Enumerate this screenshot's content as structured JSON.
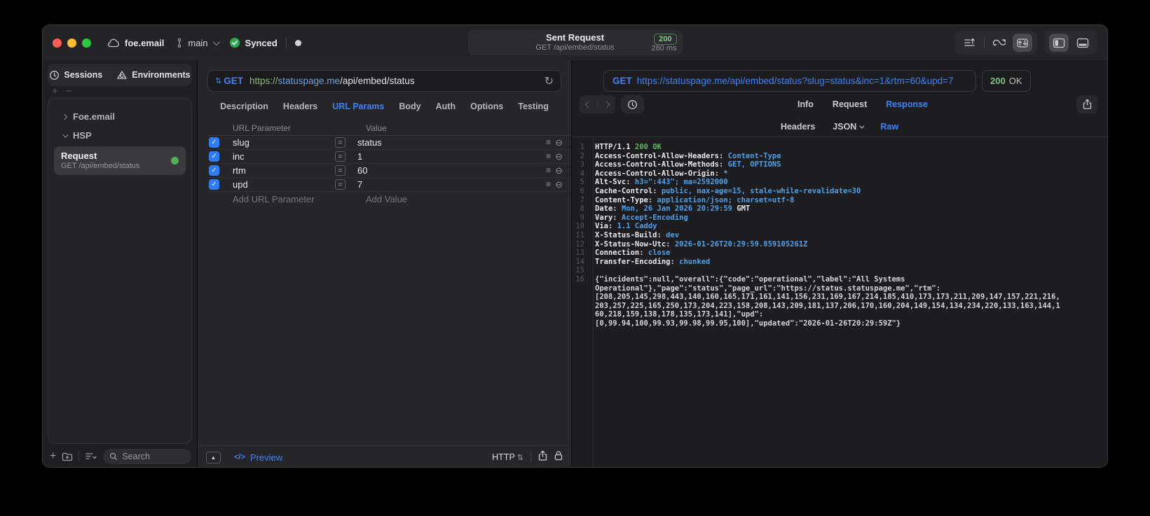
{
  "titlebar": {
    "workspace": "foe.email",
    "branch": "main",
    "sync_label": "Synced",
    "request_title": "Sent Request",
    "request_subtitle": "GET /api/embed/status",
    "status_code": "200",
    "duration": "280 ms"
  },
  "sidebar": {
    "tabs": [
      {
        "label": "Sessions"
      },
      {
        "label": "Environments"
      }
    ],
    "groups": [
      {
        "label": "Foe.email",
        "state": "collapsed"
      },
      {
        "label": "HSP",
        "state": "expanded"
      }
    ],
    "request": {
      "title": "Request",
      "subtitle": "GET /api/embed/status"
    },
    "search_placeholder": "Search"
  },
  "request_editor": {
    "method": "GET",
    "url": {
      "scheme": "https://",
      "host": "statuspage.me",
      "path": "/api/embed/status"
    },
    "tabs": [
      {
        "label": "Description"
      },
      {
        "label": "Headers"
      },
      {
        "label": "URL Params",
        "active": true
      },
      {
        "label": "Body"
      },
      {
        "label": "Auth"
      },
      {
        "label": "Options"
      },
      {
        "label": "Testing"
      }
    ],
    "params": {
      "columns": [
        "URL Parameter",
        "Value"
      ],
      "rows": [
        {
          "name": "slug",
          "value": "status",
          "enabled": true
        },
        {
          "name": "inc",
          "value": "1",
          "enabled": true
        },
        {
          "name": "rtm",
          "value": "60",
          "enabled": true
        },
        {
          "name": "upd",
          "value": "7",
          "enabled": true
        }
      ],
      "add_name_placeholder": "Add URL Parameter",
      "add_value_placeholder": "Add Value"
    },
    "footer": {
      "preview": "Preview",
      "protocol": "HTTP"
    }
  },
  "response_viewer": {
    "method": "GET",
    "url": "https://statuspage.me/api/embed/status?slug=status&inc=1&rtm=60&upd=7",
    "status": {
      "code": "200",
      "text": "OK"
    },
    "tabs": [
      {
        "label": "Info"
      },
      {
        "label": "Request"
      },
      {
        "label": "Response",
        "active": true
      }
    ],
    "view_tabs": [
      {
        "label": "Headers"
      },
      {
        "label": "JSON",
        "chevron": true
      },
      {
        "label": "Raw",
        "active": true
      }
    ],
    "lines": [
      {
        "n": "1",
        "parts": [
          [
            "HTTP/1.1 ",
            "k"
          ],
          [
            "200 OK",
            "g"
          ]
        ]
      },
      {
        "n": "2",
        "parts": [
          [
            "Access-Control-Allow-Headers",
            "k"
          ],
          [
            ": ",
            "p"
          ],
          [
            "Content-Type",
            "v"
          ]
        ]
      },
      {
        "n": "3",
        "parts": [
          [
            "Access-Control-Allow-Methods",
            "k"
          ],
          [
            ": ",
            "p"
          ],
          [
            "GET, OPTIONS",
            "v"
          ]
        ]
      },
      {
        "n": "4",
        "parts": [
          [
            "Access-Control-Allow-Origin",
            "k"
          ],
          [
            ": ",
            "p"
          ],
          [
            "*",
            "v"
          ]
        ]
      },
      {
        "n": "5",
        "parts": [
          [
            "Alt-Svc",
            "k"
          ],
          [
            ": ",
            "p"
          ],
          [
            "h3=\":443\"; ma=2592000",
            "v"
          ]
        ]
      },
      {
        "n": "6",
        "parts": [
          [
            "Cache-Control",
            "k"
          ],
          [
            ": ",
            "p"
          ],
          [
            "public, max-age=15, stale-while-revalidate=30",
            "v"
          ]
        ]
      },
      {
        "n": "7",
        "parts": [
          [
            "Content-Type",
            "k"
          ],
          [
            ": ",
            "p"
          ],
          [
            "application/json; charset=utf-8",
            "v"
          ]
        ]
      },
      {
        "n": "8",
        "parts": [
          [
            "Date",
            "k"
          ],
          [
            ": ",
            "p"
          ],
          [
            "Mon, 26 Jan 2026 20:29:59 ",
            "v"
          ],
          [
            "GMT",
            "k"
          ]
        ]
      },
      {
        "n": "9",
        "parts": [
          [
            "Vary",
            "k"
          ],
          [
            ": ",
            "p"
          ],
          [
            "Accept-Encoding",
            "v"
          ]
        ]
      },
      {
        "n": "10",
        "parts": [
          [
            "Via",
            "k"
          ],
          [
            ": ",
            "p"
          ],
          [
            "1.1 Caddy",
            "v"
          ]
        ]
      },
      {
        "n": "11",
        "parts": [
          [
            "X-Status-Build",
            "k"
          ],
          [
            ": ",
            "p"
          ],
          [
            "dev",
            "v"
          ]
        ]
      },
      {
        "n": "12",
        "parts": [
          [
            "X-Status-Now-Utc",
            "k"
          ],
          [
            ": ",
            "p"
          ],
          [
            "2026-01-26T20:29:59.859105261Z",
            "v"
          ]
        ]
      },
      {
        "n": "13",
        "parts": [
          [
            "Connection",
            "k"
          ],
          [
            ": ",
            "p"
          ],
          [
            "close",
            "v"
          ]
        ]
      },
      {
        "n": "14",
        "parts": [
          [
            "Transfer-Encoding",
            "k"
          ],
          [
            ": ",
            "p"
          ],
          [
            "chunked",
            "v"
          ]
        ]
      },
      {
        "n": "15",
        "parts": []
      },
      {
        "n": "16",
        "parts": [
          [
            "{\"incidents\":null,\"overall\":{\"code\":\"operational\",\"label\":\"All Systems",
            "p"
          ]
        ]
      },
      {
        "n": "",
        "parts": [
          [
            "Operational\"},\"page\":\"status\",\"page_url\":\"https://status.statuspage.me\",\"rtm\":",
            "p"
          ]
        ]
      },
      {
        "n": "",
        "parts": [
          [
            "[208,205,145,298,443,140,160,165,171,161,141,156,231,169,167,214,185,410,173,173,211,209,147,157,221,216,",
            "p"
          ]
        ]
      },
      {
        "n": "",
        "parts": [
          [
            "203,257,225,165,250,173,204,223,158,208,143,209,181,137,206,170,160,204,149,154,134,234,220,133,163,144,1",
            "p"
          ]
        ]
      },
      {
        "n": "",
        "parts": [
          [
            "60,218,159,138,178,135,173,141],\"upd\":",
            "p"
          ]
        ]
      },
      {
        "n": "",
        "parts": [
          [
            "[0,99.94,100,99.93,99.98,99.95,100],\"updated\":\"2026-01-26T20:29:59Z\"}",
            "p"
          ]
        ]
      }
    ]
  },
  "icons": {
    "check": "✓",
    "reorder": "≡",
    "remove": "⊖",
    "method_arrows": "⇅",
    "reload": "↻",
    "expand": "▲",
    "plus": "+",
    "minus": "−",
    "updown": "⇅",
    "code": "</>"
  },
  "colors": {
    "accent_blue": "#3e82f7",
    "checkbox_blue": "#2e7cf6",
    "success_green": "#5cb85c",
    "badge_green": "#86ca86",
    "status_dot_green": "#55b057",
    "url_scheme_green": "#8fba7c",
    "url_host_blue": "#6fa3dc",
    "value_blue": "#4fa0e8",
    "traffic_red": "#ff5f57",
    "traffic_yellow": "#febc2e",
    "traffic_green": "#28c840"
  }
}
